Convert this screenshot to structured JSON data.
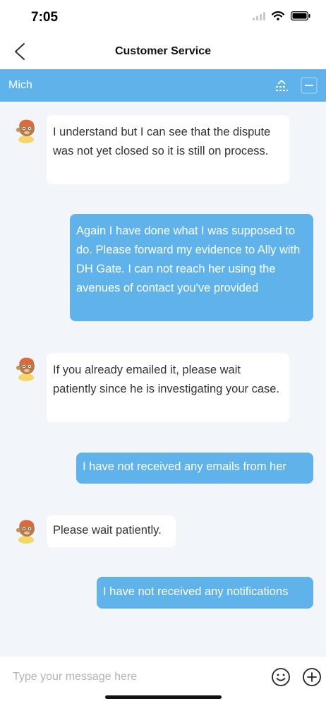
{
  "status_bar": {
    "time": "7:05",
    "icons": [
      "signal-icon",
      "wifi-icon",
      "battery-icon"
    ]
  },
  "nav": {
    "title": "Customer Service",
    "back_icon": "chevron-left-icon"
  },
  "agent_bar": {
    "name": "Mich",
    "icons": [
      "collapse-icon",
      "minimize-icon"
    ]
  },
  "messages": [
    {
      "from": "agent",
      "text": "I understand but I can see that the dispute was not yet closed so it is still on process."
    },
    {
      "from": "user",
      "text": "Again I have done what I was supposed to do. Please forward my evidence to Ally with DH Gate. I can not reach her using the avenues of contact you've provided"
    },
    {
      "from": "agent",
      "text": "If you already emailed it, please wait patiently since he is investigating your case."
    },
    {
      "from": "user",
      "text": "I have not received any emails from her"
    },
    {
      "from": "agent",
      "text": "Please wait patiently."
    },
    {
      "from": "user",
      "text": "I have not received any notifications"
    }
  ],
  "input": {
    "placeholder": "Type your message here",
    "value": ""
  },
  "icons": {
    "emoji": "smiley-icon",
    "add": "plus-circle-icon"
  },
  "colors": {
    "accent": "#5fb3ea",
    "background": "#f2f5fa",
    "bubble_in": "#ffffff",
    "text": "#333333"
  }
}
